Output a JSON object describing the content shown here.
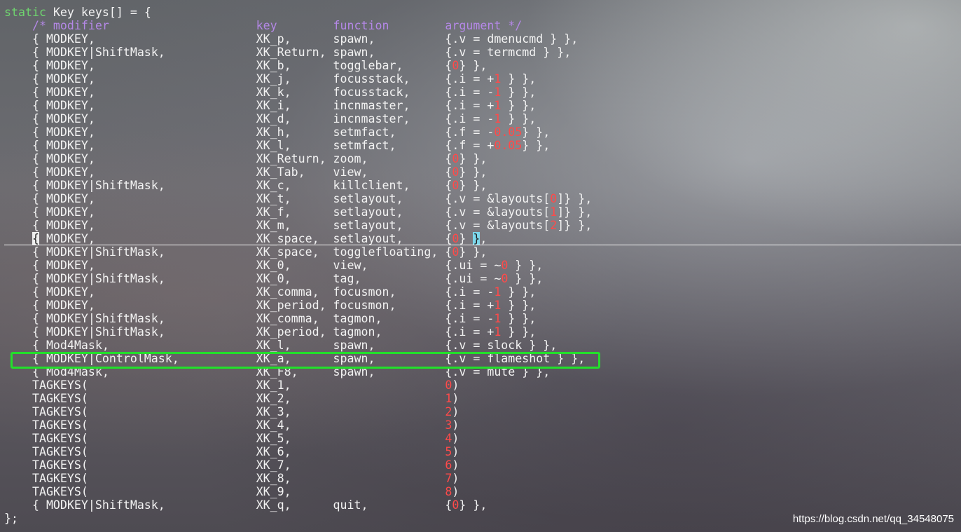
{
  "editor": {
    "lines": [
      "static Key keys[] = {",
      "\t/* modifier                     key        function        argument */",
      "\t{ MODKEY,                       XK_p,      spawn,          {.v = dmenucmd } },",
      "\t{ MODKEY|ShiftMask,             XK_Return, spawn,          {.v = termcmd } },",
      "\t{ MODKEY,                       XK_b,      togglebar,      {0} },",
      "\t{ MODKEY,                       XK_j,      focusstack,     {.i = +1 } },",
      "\t{ MODKEY,                       XK_k,      focusstack,     {.i = -1 } },",
      "\t{ MODKEY,                       XK_i,      incnmaster,     {.i = +1 } },",
      "\t{ MODKEY,                       XK_d,      incnmaster,     {.i = -1 } },",
      "\t{ MODKEY,                       XK_h,      setmfact,       {.f = -0.05} },",
      "\t{ MODKEY,                       XK_l,      setmfact,       {.f = +0.05} },",
      "\t{ MODKEY,                       XK_Return, zoom,           {0} },",
      "\t{ MODKEY,                       XK_Tab,    view,           {0} },",
      "\t{ MODKEY|ShiftMask,             XK_c,      killclient,     {0} },",
      "\t{ MODKEY,                       XK_t,      setlayout,      {.v = &layouts[0]} },",
      "\t{ MODKEY,                       XK_f,      setlayout,      {.v = &layouts[1]} },",
      "\t{ MODKEY,                       XK_m,      setlayout,      {.v = &layouts[2]} },",
      "\t{ MODKEY,                       XK_space,  setlayout,      {0} },",
      "\t{ MODKEY|ShiftMask,             XK_space,  togglefloating, {0} },",
      "\t{ MODKEY,                       XK_0,      view,           {.ui = ~0 } },",
      "\t{ MODKEY|ShiftMask,             XK_0,      tag,            {.ui = ~0 } },",
      "\t{ MODKEY,                       XK_comma,  focusmon,       {.i = -1 } },",
      "\t{ MODKEY,                       XK_period, focusmon,       {.i = +1 } },",
      "\t{ MODKEY|ShiftMask,             XK_comma,  tagmon,         {.i = -1 } },",
      "\t{ MODKEY|ShiftMask,             XK_period, tagmon,         {.i = +1 } },",
      "\t{ Mod4Mask,                     XK_l,      spawn,          {.v = slock } },",
      "\t{ MODKEY|ControlMask,           XK_a,      spawn,          {.v = flameshot } },",
      "\t{ Mod4Mask,                     XK_F8,     spawn,          {.v = mute } },",
      "\tTAGKEYS(                        XK_1,                      0)",
      "\tTAGKEYS(                        XK_2,                      1)",
      "\tTAGKEYS(                        XK_3,                      2)",
      "\tTAGKEYS(                        XK_4,                      3)",
      "\tTAGKEYS(                        XK_5,                      4)",
      "\tTAGKEYS(                        XK_6,                      5)",
      "\tTAGKEYS(                        XK_7,                      6)",
      "\tTAGKEYS(                        XK_8,                      7)",
      "\tTAGKEYS(                        XK_9,                      8)",
      "\t{ MODKEY|ShiftMask,             XK_q,      quit,           {0} },",
      "};"
    ],
    "highlighted_line": "\t{ MODKEY|ControlMask,           XK_a,      spawn,          {.v = flameshot } },",
    "cursor_line": "\t{ MODKEY,                       XK_space,  setlayout,      {0} },"
  },
  "watermark": "https://blog.csdn.net/qq_34548075",
  "colors": {
    "text": "#f2f2f2",
    "keyword": "#6fd46f",
    "comment": "#b488e6",
    "number": "#ff4a4a",
    "highlight_box": "#22e02a",
    "bracket_match": "#7dd8ec"
  }
}
